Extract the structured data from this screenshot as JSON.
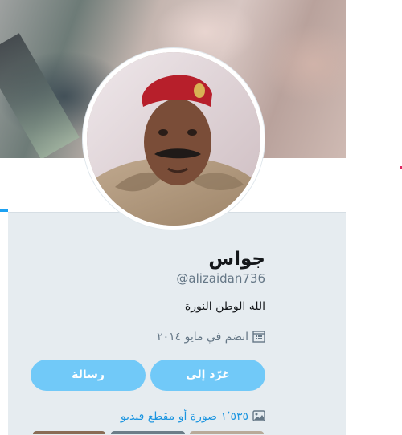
{
  "profile": {
    "name": "جواس",
    "handle": "@alizaidan736",
    "bio": "الله الوطن النورة",
    "joined": "انضم في مايو ٢٠١٤"
  },
  "actions": {
    "tweet_to": "غرّد إلى",
    "message": "رسالة"
  },
  "media": {
    "label": "١٬٥٣٥ صورة أو مقطع فيديو"
  },
  "icons": {
    "calendar": "calendar-icon",
    "media": "image-icon"
  },
  "colors": {
    "accent": "#1da1f2",
    "button": "#71c9f8",
    "card_bg": "#e6ecf0",
    "link": "#1b95e0"
  }
}
